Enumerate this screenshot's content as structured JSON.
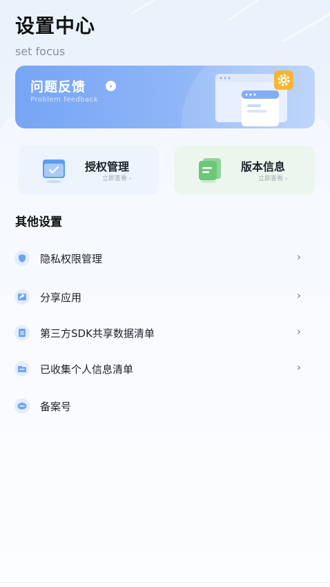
{
  "header": {
    "title": "设置中心",
    "subtitle": "set focus"
  },
  "feedback_banner": {
    "title": "问题反馈",
    "subtitle": "Problem feedback",
    "arrow": "›",
    "accent_color": "#7aa8f5",
    "gear_color": "#f7b531"
  },
  "quick_cards": {
    "auth": {
      "label": "授权管理",
      "hint": "立即查看 ›",
      "icon": "clipboard-check-icon",
      "color": "#5b9cf3"
    },
    "version": {
      "label": "版本信息",
      "hint": "立即查看 ›",
      "icon": "document-icon",
      "color": "#6cc77a"
    }
  },
  "other_settings": {
    "title": "其他设置",
    "items": [
      {
        "label": "隐私权限管理",
        "icon": "shield-icon",
        "chevron": "›"
      },
      {
        "label": "分享应用",
        "icon": "share-icon",
        "chevron": "›"
      },
      {
        "label": "第三方SDK共享数据清单",
        "icon": "list-icon",
        "chevron": "›"
      },
      {
        "label": "已收集个人信息清单",
        "icon": "folder-icon",
        "chevron": "›"
      },
      {
        "label": "备案号",
        "icon": "record-icon",
        "chevron": ""
      }
    ]
  }
}
